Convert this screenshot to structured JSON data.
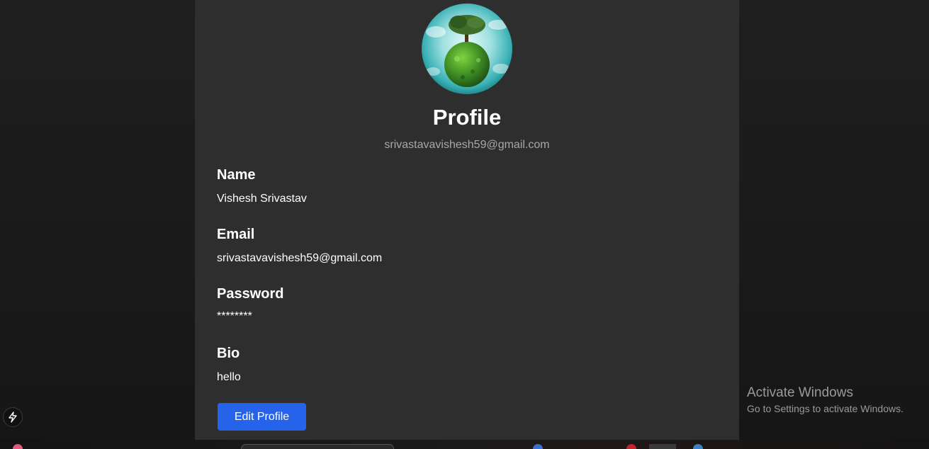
{
  "profile": {
    "title": "Profile",
    "email_header": "srivastavavishesh59@gmail.com",
    "fields": [
      {
        "label": "Name",
        "value": "Vishesh Srivastav"
      },
      {
        "label": "Email",
        "value": "srivastavavishesh59@gmail.com"
      },
      {
        "label": "Password",
        "value": "********"
      },
      {
        "label": "Bio",
        "value": "hello"
      }
    ],
    "edit_button_label": "Edit Profile"
  },
  "watermark": {
    "title": "Activate Windows",
    "subtitle": "Go to Settings to activate Windows."
  },
  "colors": {
    "background": "#1a1a1a",
    "card": "#2e2e2e",
    "accent": "#2563eb",
    "muted_text": "#a8a8a8"
  },
  "icons": {
    "avatar": "globe-tree-avatar",
    "dev_tools": "lightning-bolt-icon"
  }
}
